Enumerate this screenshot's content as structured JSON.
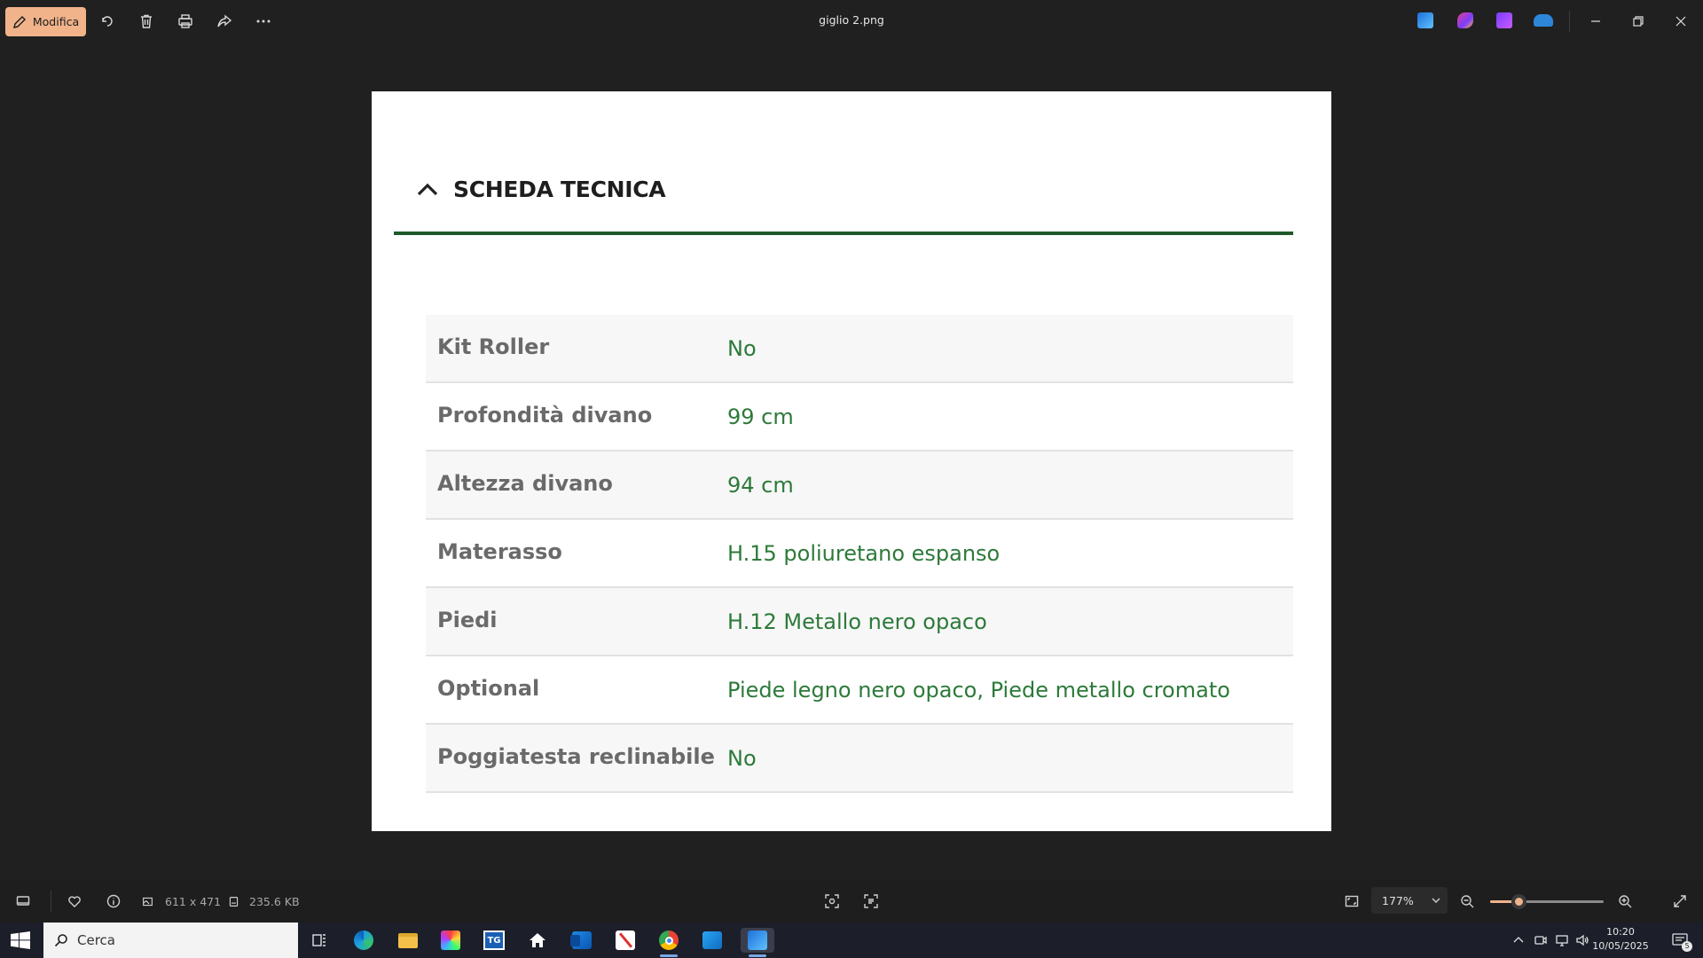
{
  "window": {
    "title": "giglio 2.png",
    "edit_label": "Modifica"
  },
  "toolbar": {
    "icons": [
      "rotate-icon",
      "trash-icon",
      "print-icon",
      "share-icon",
      "more-icon"
    ]
  },
  "image": {
    "section_title": "SCHEDA TECNICA",
    "specs": [
      {
        "key": "Kit Roller",
        "value": "No"
      },
      {
        "key": "Profondità divano",
        "value": "99 cm"
      },
      {
        "key": "Altezza divano",
        "value": "94 cm"
      },
      {
        "key": "Materasso",
        "value": "H.15 poliuretano espanso"
      },
      {
        "key": "Piedi",
        "value": "H.12 Metallo nero opaco"
      },
      {
        "key": "Optional",
        "value": "Piede legno nero opaco, Piede metallo cromato"
      },
      {
        "key": "Poggiatesta reclinabile",
        "value": "No"
      }
    ],
    "colors": {
      "rule": "#1f5a2a",
      "value_text": "#2d7a3a",
      "key_text": "#6a6a6a"
    }
  },
  "statusbar": {
    "dimensions": "611 x 471",
    "file_size": "235.6 KB",
    "zoom": "177%",
    "zoom_slider_fraction": 0.25
  },
  "taskbar": {
    "search_placeholder": "Cerca",
    "time": "10:20",
    "date": "10/05/2025",
    "notification_count": "5"
  },
  "accent_color": "#f0b38a"
}
